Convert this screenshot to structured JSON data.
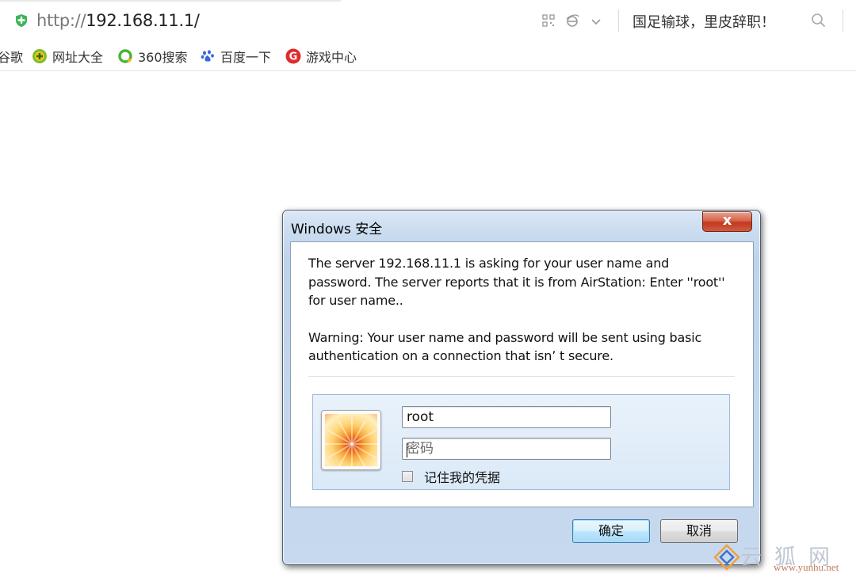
{
  "browser": {
    "url_protocol": "http://",
    "url_host": "192.168.11.1/",
    "news_ticker": "国足输球，里皮辞职！"
  },
  "bookmarks": [
    {
      "label": "谷歌",
      "icon": "none"
    },
    {
      "label": "网址大全",
      "icon": "plus-circle-icon"
    },
    {
      "label": "360搜索",
      "icon": "ring-icon"
    },
    {
      "label": "百度一下",
      "icon": "paw-icon"
    },
    {
      "label": "游戏中心",
      "icon": "game-center-icon"
    }
  ],
  "dialog": {
    "title": "Windows 安全",
    "close_label": "x",
    "message": "The server 192.168.11.1 is asking for your user name and password. The server reports that it is from AirStation: Enter ''root'' for user name..",
    "warning": "Warning: Your user name and password will be sent using basic authentication on a connection that isn’ t secure.",
    "username_value": "root",
    "password_placeholder": "密码",
    "remember_label": "记住我的凭据",
    "ok_label": "确定",
    "cancel_label": "取消"
  },
  "watermark": {
    "text": "云狐网",
    "url": "www.yunhu.net"
  },
  "colors": {
    "close_button": "#c8422a",
    "ok_button_border": "#3c7fb1",
    "panel_border": "#9fbbd8"
  }
}
